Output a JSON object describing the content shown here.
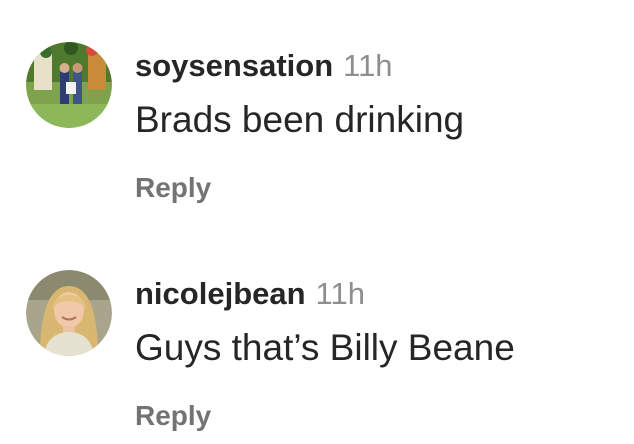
{
  "comments": [
    {
      "username": "soysensation",
      "timestamp": "11h",
      "text": "Brads been drinking",
      "reply_label": "Reply",
      "avatar": "profile-photo-family-outdoors"
    },
    {
      "username": "nicolejbean",
      "timestamp": "11h",
      "text": "Guys that’s Billy Beane",
      "reply_label": "Reply",
      "avatar": "profile-photo-blonde-woman"
    }
  ],
  "colors": {
    "text_primary": "#262626",
    "text_secondary": "#8e8e8e",
    "reply": "#737373",
    "background": "#ffffff"
  }
}
